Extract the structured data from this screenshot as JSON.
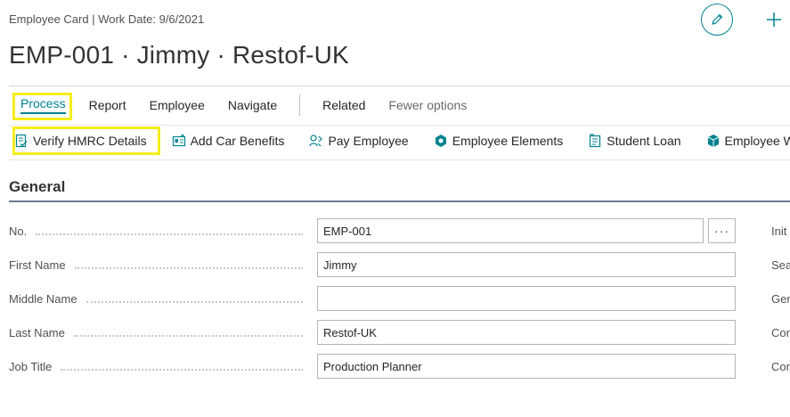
{
  "header": {
    "subtitle": "Employee Card | Work Date: 9/6/2021",
    "title": "EMP-001 · Jimmy · Restof-UK"
  },
  "tabs": [
    {
      "label": "Process"
    },
    {
      "label": "Report"
    },
    {
      "label": "Employee"
    },
    {
      "label": "Navigate"
    },
    {
      "label": "Related"
    },
    {
      "label": "Fewer options"
    }
  ],
  "actions": [
    {
      "label": "Verify HMRC Details",
      "icon": "verify-document-icon"
    },
    {
      "label": "Add Car Benefits",
      "icon": "add-card-icon"
    },
    {
      "label": "Pay Employee",
      "icon": "pay-employee-icon"
    },
    {
      "label": "Employee Elements",
      "icon": "hexagon-icon"
    },
    {
      "label": "Student Loan",
      "icon": "student-loan-icon"
    },
    {
      "label": "Employee Wor",
      "icon": "cube-icon"
    }
  ],
  "section": {
    "title": "General"
  },
  "fields": [
    {
      "label": "No.",
      "value": "EMP-001"
    },
    {
      "label": "First Name",
      "value": "Jimmy"
    },
    {
      "label": "Middle Name",
      "value": ""
    },
    {
      "label": "Last Name",
      "value": "Restof-UK"
    },
    {
      "label": "Job Title",
      "value": "Production Planner"
    }
  ],
  "more_button": "···",
  "right_labels": [
    "Init",
    "Sea",
    "Ger",
    "Cor",
    "Cor"
  ],
  "colors": {
    "accent": "#00838f",
    "highlight": "#f5ec1c"
  }
}
